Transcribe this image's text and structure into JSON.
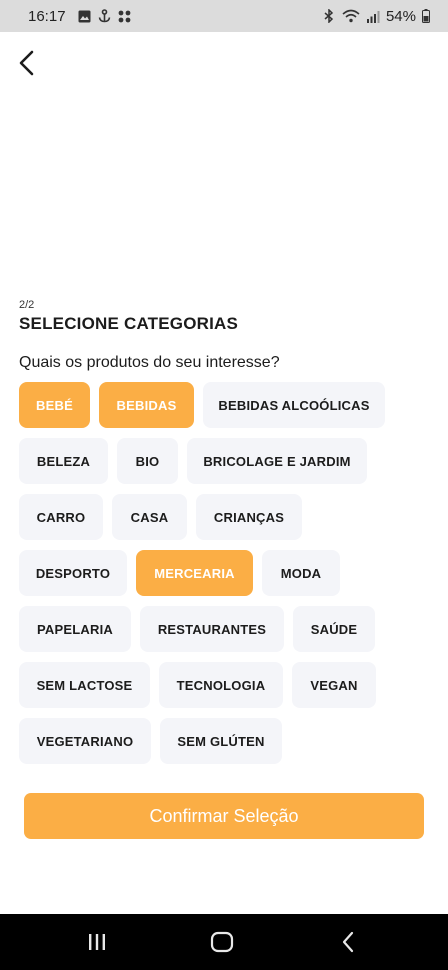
{
  "status_bar": {
    "time": "16:17",
    "left_icons": [
      "image-icon",
      "anchor-icon",
      "grid-icon"
    ],
    "right_icons": [
      "bluetooth-icon",
      "wifi-icon",
      "signal-icon",
      "battery-icon"
    ],
    "battery": "54%"
  },
  "header": {
    "back_icon": "chevron-left-icon"
  },
  "content": {
    "step": "2/2",
    "title": "SELECIONE CATEGORIAS",
    "question": "Quais os produtos do seu interesse?"
  },
  "categories": [
    {
      "label": "BEBÉ",
      "selected": true
    },
    {
      "label": "BEBIDAS",
      "selected": true
    },
    {
      "label": "BEBIDAS ALCOÓLICAS",
      "selected": false
    },
    {
      "label": "BELEZA",
      "selected": false
    },
    {
      "label": "BIO",
      "selected": false
    },
    {
      "label": "BRICOLAGE E JARDIM",
      "selected": false
    },
    {
      "label": "CARRO",
      "selected": false
    },
    {
      "label": "CASA",
      "selected": false
    },
    {
      "label": "CRIANÇAS",
      "selected": false
    },
    {
      "label": "DESPORTO",
      "selected": false
    },
    {
      "label": "MERCEARIA",
      "selected": true
    },
    {
      "label": "MODA",
      "selected": false
    },
    {
      "label": "PAPELARIA",
      "selected": false
    },
    {
      "label": "RESTAURANTES",
      "selected": false
    },
    {
      "label": "SAÚDE",
      "selected": false
    },
    {
      "label": "SEM LACTOSE",
      "selected": false
    },
    {
      "label": "TECNOLOGIA",
      "selected": false
    },
    {
      "label": "VEGAN",
      "selected": false
    },
    {
      "label": "VEGETARIANO",
      "selected": false
    },
    {
      "label": "SEM GLÚTEN",
      "selected": false
    }
  ],
  "confirm_button": {
    "label": "Confirmar Seleção"
  },
  "colors": {
    "accent": "#fbae45",
    "chip_bg": "#f4f5f9",
    "text": "#1c1c1c"
  },
  "nav_bar": {
    "icons": [
      "recent-apps-icon",
      "home-icon",
      "back-icon"
    ]
  }
}
